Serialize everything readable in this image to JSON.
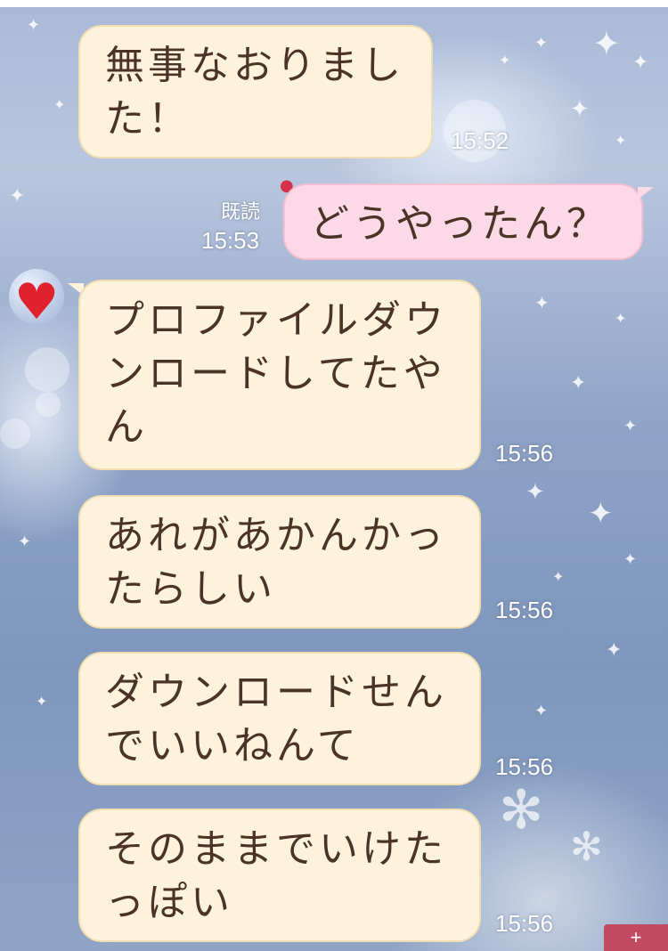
{
  "chat": {
    "messages": [
      {
        "side": "received",
        "text_lines": [
          "無事なおりまし",
          "た！"
        ],
        "time": "15:52"
      },
      {
        "side": "sent",
        "text_lines": [
          "どうやったん？"
        ],
        "time": "15:53",
        "status": "既読"
      },
      {
        "side": "received",
        "text_lines": [
          "プロファイルダウ",
          "ンロードしてたや",
          "ん"
        ],
        "time": "15:56"
      },
      {
        "side": "received",
        "text_lines": [
          "あれがあかんかっ",
          "たらしい"
        ],
        "time": "15:56"
      },
      {
        "side": "received",
        "text_lines": [
          "ダウンロードせん",
          "でいいねんて"
        ],
        "time": "15:56"
      },
      {
        "side": "received",
        "text_lines": [
          "そのままでいけた",
          "っぽい"
        ],
        "time": "15:56"
      }
    ]
  },
  "contact": {
    "avatar_icon": "heart-avatar-icon"
  },
  "colors": {
    "received_bubble": "#fdf2dc",
    "sent_bubble": "#fcd9e6",
    "bubble_text": "#4b3326",
    "timestamp": "#ffffff",
    "scroll_button": "#c44a62"
  },
  "scroll_button": {
    "icon": "plus-icon"
  }
}
